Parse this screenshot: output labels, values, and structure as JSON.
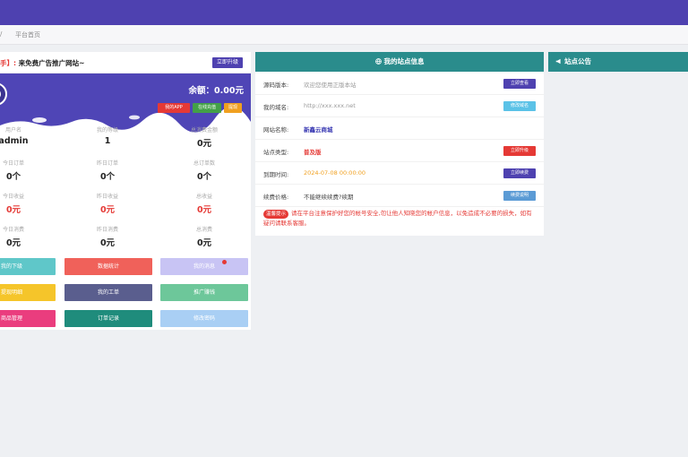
{
  "breadcrumb": {
    "sep": "/",
    "current": "平台首页"
  },
  "user_panel": {
    "title_prefix": "手】:",
    "title_text": "来免费广告推广网站~",
    "action_btn": "立即升级",
    "balance": "余额：0.00元",
    "mini_buttons": [
      {
        "label": "我的APP",
        "color": "#e53935"
      },
      {
        "label": "在线充值",
        "color": "#43a047"
      },
      {
        "label": "提现",
        "color": "#f0a020"
      }
    ],
    "stats": [
      {
        "label": "用户名",
        "value": "admin",
        "red": false
      },
      {
        "label": "我的等级",
        "value": "1",
        "red": false
      },
      {
        "label": "总消费金额",
        "value": "0元",
        "red": false
      },
      {
        "label": "今日订单",
        "value": "0个",
        "red": false
      },
      {
        "label": "昨日订单",
        "value": "0个",
        "red": false
      },
      {
        "label": "总订单数",
        "value": "0个",
        "red": false
      },
      {
        "label": "今日收益",
        "value": "0元",
        "red": true
      },
      {
        "label": "昨日收益",
        "value": "0元",
        "red": true
      },
      {
        "label": "总收益",
        "value": "0元",
        "red": true
      },
      {
        "label": "今日消费",
        "value": "0元",
        "red": false
      },
      {
        "label": "昨日消费",
        "value": "0元",
        "red": false
      },
      {
        "label": "总消费",
        "value": "0元",
        "red": false
      }
    ],
    "quick_buttons": [
      {
        "label": "我的下级",
        "color": "#5fc7c9"
      },
      {
        "label": "数据统计",
        "color": "#f0615a"
      },
      {
        "label": "我的消息",
        "color": "#c8c4f4"
      },
      {
        "label": "提现明细",
        "color": "#f5c52a"
      },
      {
        "label": "我的工单",
        "color": "#5a5e8e"
      },
      {
        "label": "推广赚钱",
        "color": "#6dc79a"
      },
      {
        "label": "商品管理",
        "color": "#ea3d7e"
      },
      {
        "label": "订单记录",
        "color": "#1f8c7c"
      },
      {
        "label": "修改密码",
        "color": "#a9cff4"
      }
    ]
  },
  "info_panel": {
    "header": "我的站点信息",
    "header_color": "#2a8c8c",
    "rows": [
      {
        "key": "源码版本:",
        "value": "欢迎您使用正版本站",
        "value_color": "#999",
        "value_bold": false,
        "btn": "立即查看",
        "btn_color": "#4e41b0"
      },
      {
        "key": "我的域名:",
        "value": "http://xxx.xxx.net",
        "value_color": "#999",
        "value_bold": false,
        "btn": "修改域名",
        "btn_color": "#5bc2e7"
      },
      {
        "key": "网站名称:",
        "value": "新鑫云商城",
        "value_color": "#3b3bb3",
        "value_bold": true,
        "btn": "",
        "btn_color": ""
      },
      {
        "key": "站点类型:",
        "value": "普及版",
        "value_color": "#e53935",
        "value_bold": true,
        "btn": "立即升级",
        "btn_color": "#e53935"
      },
      {
        "key": "到期时间:",
        "value": "2024-07-08 00:00:00",
        "value_color": "#f0a020",
        "value_bold": false,
        "btn": "立即续费",
        "btn_color": "#4e41b0"
      },
      {
        "key": "续费价格:",
        "value": "不能继续续费?续期",
        "value_color": "#444",
        "value_bold": false,
        "btn": "续费说明",
        "btn_color": "#5b9bd5"
      }
    ],
    "notice_tag": "温馨提示",
    "notice_text": "请在平台注意保护好您的帐号安全,勿让他人知晓您的帐户信息，以免造成不必要的损失，如有疑问请联系客服。"
  },
  "notice_panel": {
    "header": "站点公告",
    "header_color": "#2a8c8c"
  },
  "colors": {
    "topbar": "#4e41b0",
    "banner": "#4f45b6"
  }
}
